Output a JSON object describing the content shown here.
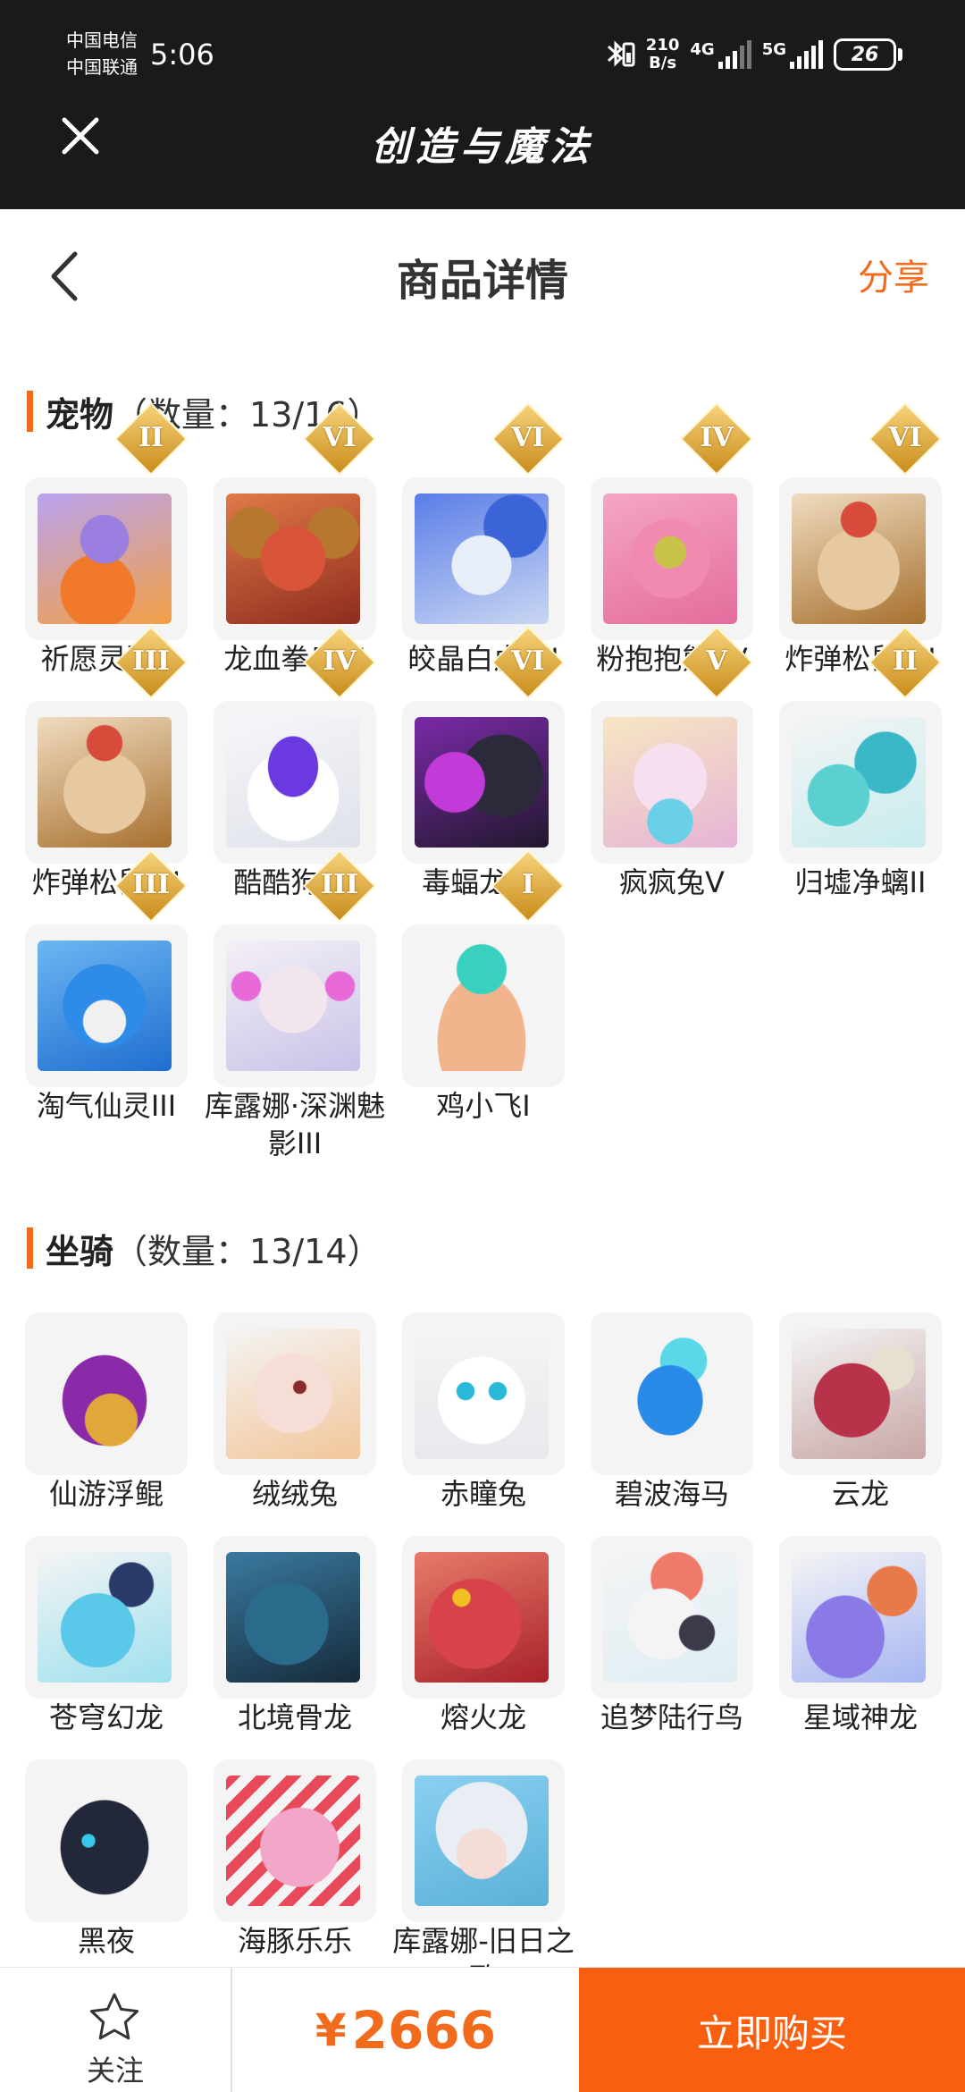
{
  "status_bar": {
    "carrier_1": "中国电信",
    "carrier_2": "中国联通",
    "time": "5:06",
    "speed_value": "210",
    "speed_unit": "B/s",
    "net_1": "4G",
    "net_2": "5G",
    "battery": "26"
  },
  "app": {
    "title": "创造与魔法"
  },
  "header": {
    "title": "商品详情",
    "share_label": "分享"
  },
  "pets_section": {
    "name": "宠物",
    "count_text": "（数量：13/16）"
  },
  "pets": [
    {
      "label": "祈愿灵翼II",
      "rank": "II"
    },
    {
      "label": "龙血拳皇VI",
      "rank": "VI"
    },
    {
      "label": "皎晶白虎 VI",
      "rank": "VI"
    },
    {
      "label": "粉抱抱熊 IV",
      "rank": "IV"
    },
    {
      "label": "炸弹松鼠 VI",
      "rank": "VI"
    },
    {
      "label": "炸弹松鼠 III",
      "rank": "III"
    },
    {
      "label": "酷酷狗 IV",
      "rank": "IV"
    },
    {
      "label": "毒蝠龙 VI",
      "rank": "VI"
    },
    {
      "label": "疯疯兔V",
      "rank": "V"
    },
    {
      "label": "归墟净螭II",
      "rank": "II"
    },
    {
      "label": "淘气仙灵III",
      "rank": "III"
    },
    {
      "label": "库露娜·深渊魅影III",
      "rank": "III"
    },
    {
      "label": "鸡小飞I",
      "rank": "I"
    }
  ],
  "mounts_section": {
    "name": "坐骑",
    "count_text": "（数量：13/14）"
  },
  "mounts": [
    {
      "label": "仙游浮鲲"
    },
    {
      "label": "绒绒兔"
    },
    {
      "label": "赤瞳兔"
    },
    {
      "label": "碧波海马"
    },
    {
      "label": "云龙"
    },
    {
      "label": "苍穹幻龙"
    },
    {
      "label": "北境骨龙"
    },
    {
      "label": "熔火龙"
    },
    {
      "label": "追梦陆行鸟"
    },
    {
      "label": "星域神龙"
    },
    {
      "label": "黑夜"
    },
    {
      "label": "海豚乐乐"
    },
    {
      "label": "库露娜-旧日之歌"
    }
  ],
  "bottom_bar": {
    "follow_label": "关注",
    "currency": "¥",
    "price": "2666",
    "buy_label": "立即购买"
  },
  "colors": {
    "accent": "#f26b1d",
    "buy_button": "#fa5f0f",
    "topbar": "#1a1a1a"
  },
  "icons": [
    "close-icon",
    "back-arrow-icon",
    "star-icon",
    "bluetooth-icon",
    "signal-icon",
    "battery-icon"
  ]
}
